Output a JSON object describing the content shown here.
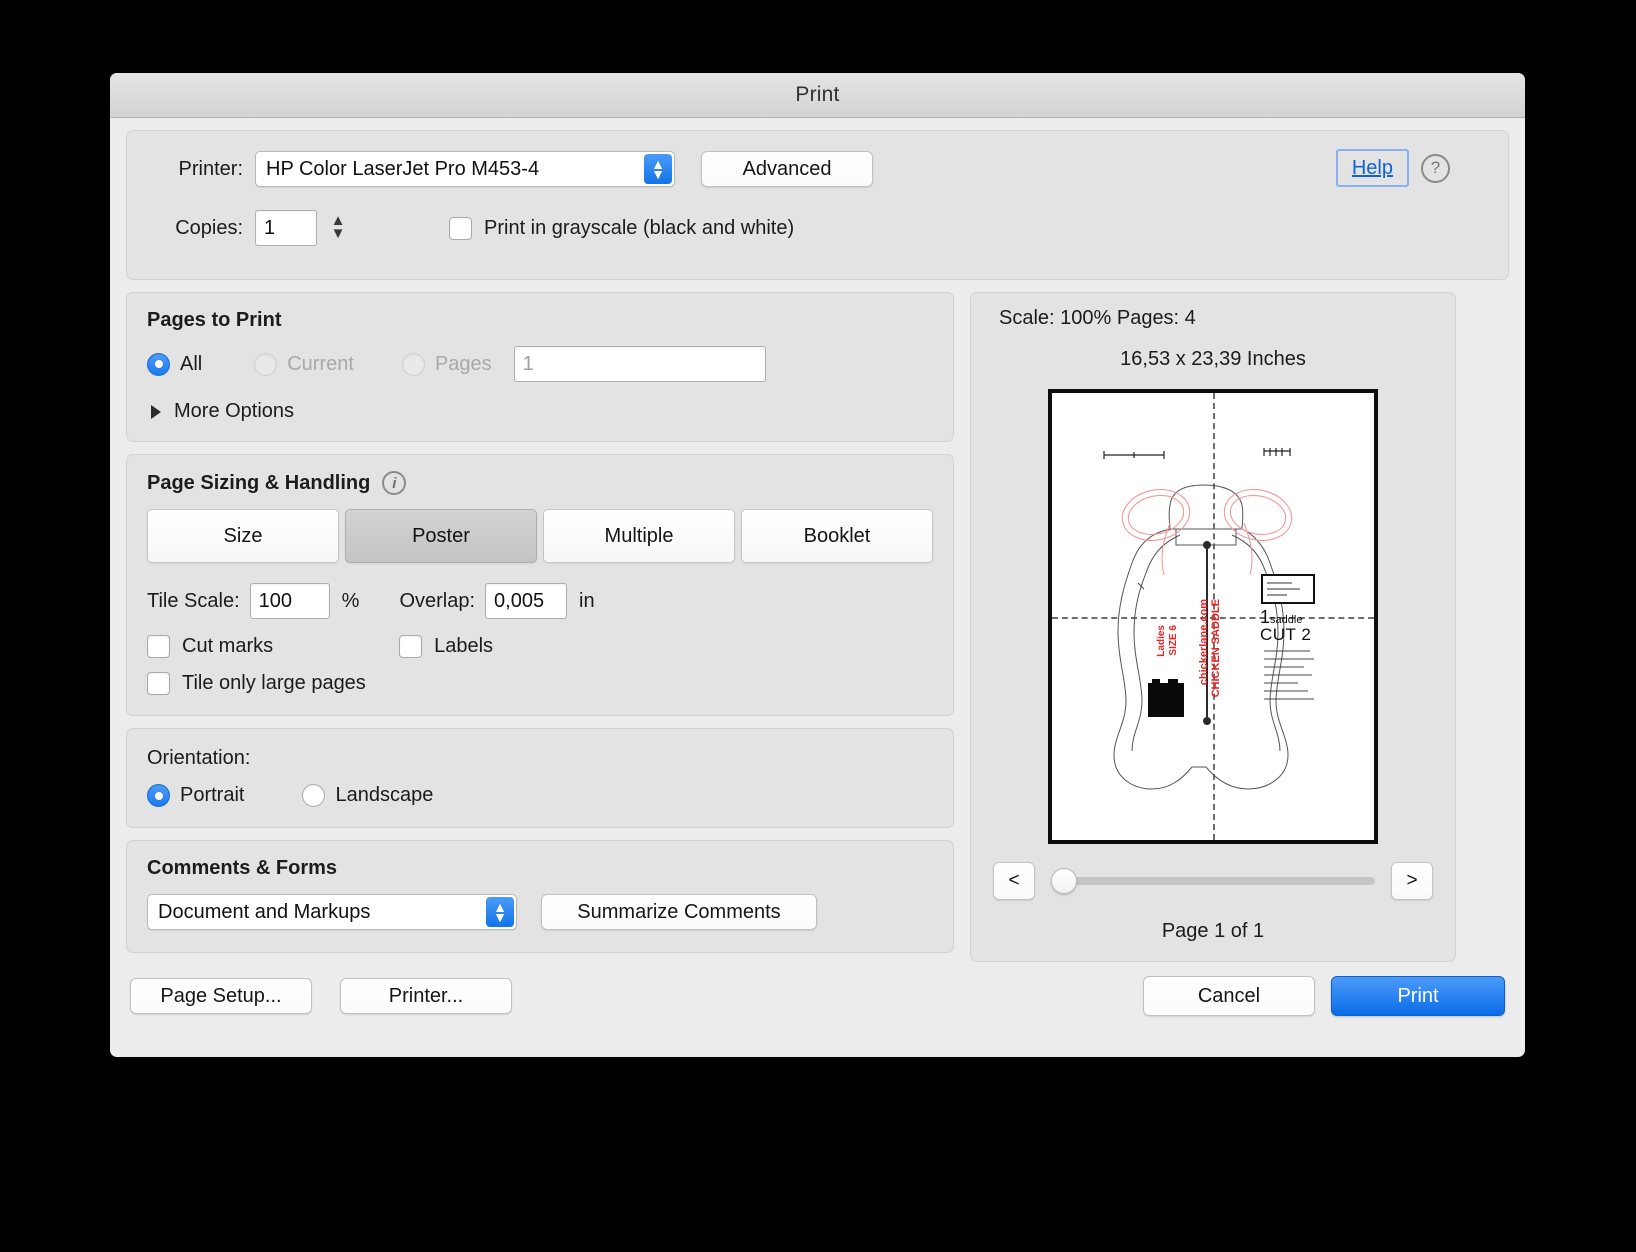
{
  "window": {
    "title": "Print"
  },
  "printer": {
    "label": "Printer:",
    "selected": "HP Color LaserJet Pro M453-4",
    "advanced_label": "Advanced",
    "help_label": "Help",
    "help_icon": "question-mark-circle-icon",
    "copies_label": "Copies:",
    "copies_value": "1",
    "grayscale_label": "Print in grayscale (black and white)",
    "grayscale_checked": false
  },
  "pages_to_print": {
    "title": "Pages to Print",
    "options": [
      {
        "label": "All",
        "selected": true,
        "disabled": false
      },
      {
        "label": "Current",
        "selected": false,
        "disabled": true
      },
      {
        "label": "Pages",
        "selected": false,
        "disabled": true
      }
    ],
    "pages_field_value": "1",
    "more_options_label": "More Options"
  },
  "page_sizing": {
    "title": "Page Sizing & Handling",
    "info_icon": "info-circle-icon",
    "modes": [
      {
        "label": "Size",
        "selected": false
      },
      {
        "label": "Poster",
        "selected": true
      },
      {
        "label": "Multiple",
        "selected": false
      },
      {
        "label": "Booklet",
        "selected": false
      }
    ],
    "tile_scale_label": "Tile Scale:",
    "tile_scale_value": "100",
    "percent_unit": "%",
    "overlap_label": "Overlap:",
    "overlap_value": "0,005",
    "inch_unit": "in",
    "cut_marks_label": "Cut marks",
    "cut_marks_checked": false,
    "labels_label": "Labels",
    "labels_checked": false,
    "tile_only_large_label": "Tile only large pages",
    "tile_only_large_checked": false
  },
  "orientation": {
    "title": "Orientation:",
    "options": [
      {
        "label": "Portrait",
        "selected": true
      },
      {
        "label": "Landscape",
        "selected": false
      }
    ]
  },
  "comments": {
    "title": "Comments & Forms",
    "selected": "Document and Markups",
    "summarize_label": "Summarize Comments"
  },
  "preview": {
    "scale_line": "Scale: 100% Pages: 4",
    "dims_line": "16,53 x 23,39 Inches",
    "prev_label": "<",
    "next_label": ">",
    "page_count": "Page 1 of 1",
    "slider_position_percent": 0,
    "artwork": {
      "piece_number": "1",
      "piece_name": "saddle",
      "cut_label": "CUT 2",
      "red_text_1": "chickerlane.com",
      "red_text_2": "CHICKEN SADDLE",
      "red_text_3": "Ladies",
      "red_text_4": "SIZE 6"
    }
  },
  "footer": {
    "page_setup_label": "Page Setup...",
    "printer_label": "Printer...",
    "cancel_label": "Cancel",
    "print_label": "Print"
  },
  "colors": {
    "accent_blue": "#1a7aee",
    "link_blue": "#1062d6",
    "window_bg": "#ececec",
    "group_bg": "#e3e3e3",
    "artwork_red": "#ee2222"
  }
}
